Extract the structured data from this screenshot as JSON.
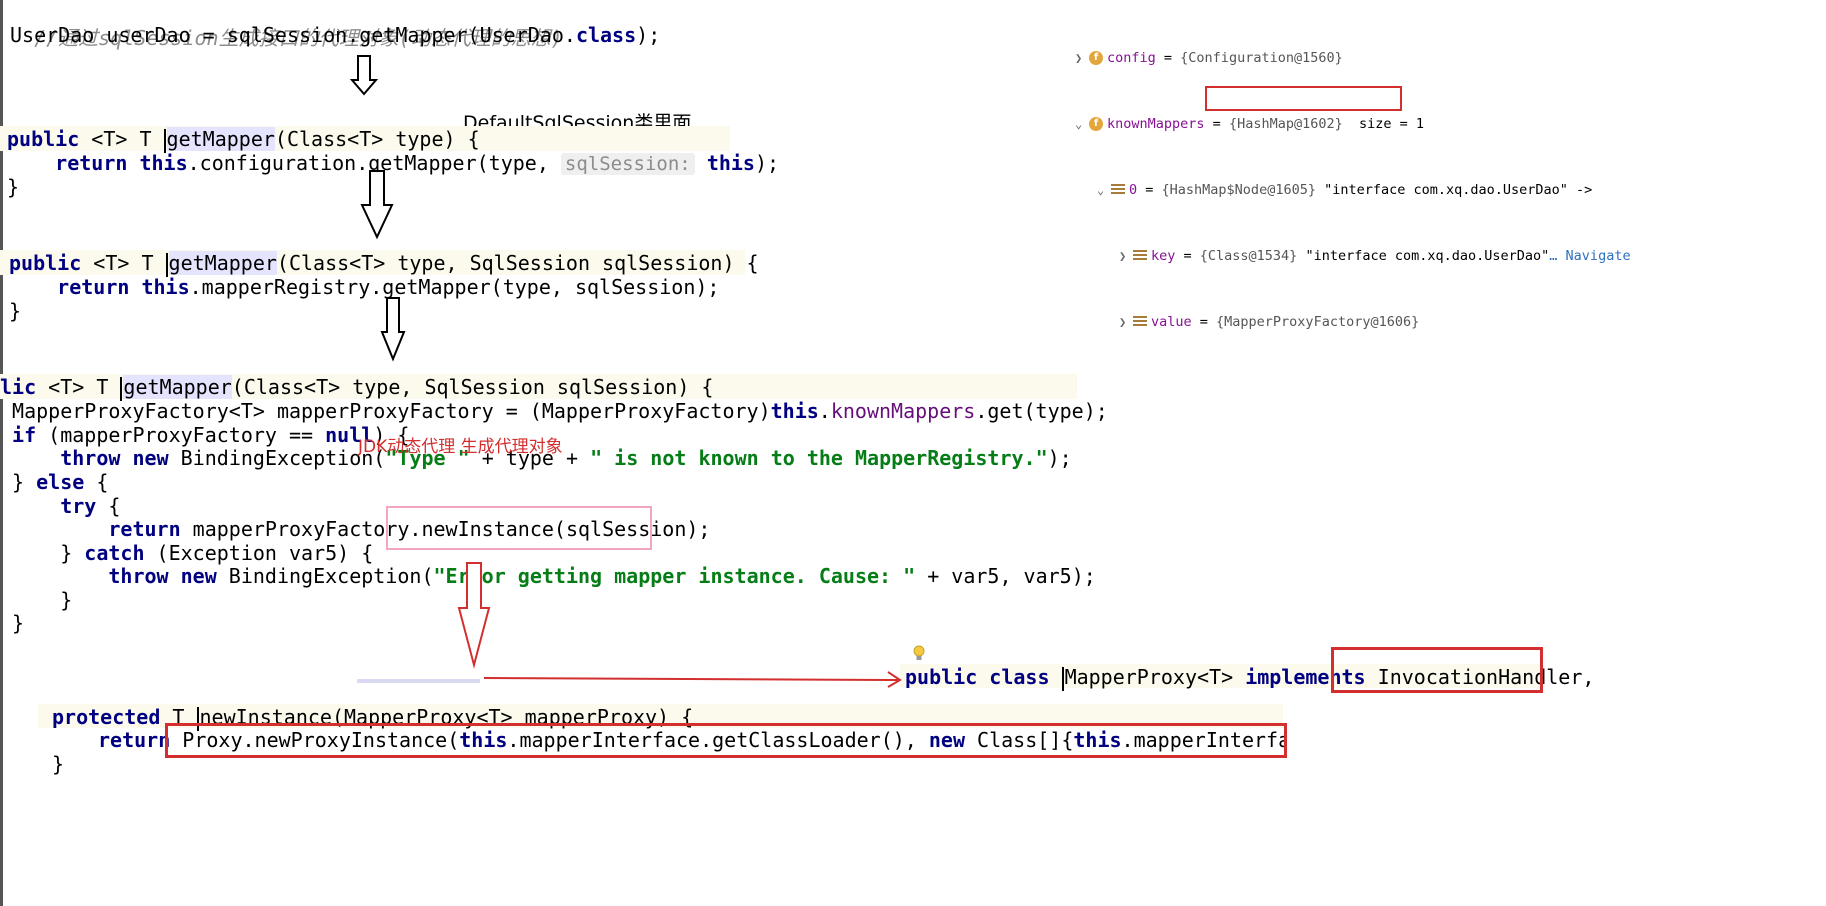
{
  "top_snippet": {
    "comment": "//通过sqlSession生成接口的代理对象(动态代理的思想)",
    "line": [
      "UserDao userDao = sqlSession.getMapper(UserDao.",
      "class",
      ");"
    ]
  },
  "annotation_default": "DefaultSqlSession类里面",
  "annotation_jdk": "JDK动态代理 生成代理对象",
  "block1": {
    "sig": [
      "public",
      " <T> T ",
      "getMapper",
      "(Class<T> type) {"
    ],
    "body": [
      "    ",
      "return",
      " ",
      "this",
      ".configuration.getMapper(type, ",
      "sqlSession:",
      " ",
      "this",
      ");"
    ],
    "close": "}"
  },
  "block2": {
    "sig": [
      "public",
      " <T> T ",
      "getMapper",
      "(Class<T> type, SqlSession sqlSession) {"
    ],
    "body": [
      "    ",
      "return",
      " ",
      "this",
      ".mapperRegistry.getMapper(type, sqlSession);"
    ],
    "close": "}"
  },
  "block3": {
    "sig": [
      "lic",
      " <T> T ",
      "getMapper",
      "(Class<T> type, SqlSession sqlSession) {"
    ],
    "l1": [
      " MapperProxyFactory<T> mapperProxyFactory = (MapperProxyFactory)",
      "this",
      ".",
      "knownMappers",
      ".get(type);"
    ],
    "l2": [
      " ",
      "if",
      " (mapperProxyFactory == ",
      "null",
      ") {"
    ],
    "l3": [
      "     ",
      "throw",
      " ",
      "new",
      " BindingException(",
      "\"Type \"",
      " + type + ",
      "\" is not known to the MapperRegistry.\"",
      ");"
    ],
    "l4": [
      " } ",
      "else",
      " {"
    ],
    "l5": [
      "     ",
      "try",
      " {"
    ],
    "l6": [
      "         ",
      "return",
      " mapperProxyFactory.",
      "newInstance(sqlSession)",
      ";"
    ],
    "l7": [
      "     } ",
      "catch",
      " (Exception var5) {"
    ],
    "l8": [
      "         ",
      "throw",
      " ",
      "new",
      " BindingException(",
      "\"Error getting mapper instance. Cause: \"",
      " + var5, var5);"
    ],
    "l9": "     }",
    "l10": " }"
  },
  "block4": {
    "sig": [
      "protected",
      " T ",
      "newInstance",
      "(MapperProxy<T> mapperProxy) {"
    ],
    "body": [
      "return",
      " ",
      "Proxy.newProxyInstance(",
      "this",
      ".mapperInterface.getClassLoader(), ",
      "new",
      " Class[]{",
      "this",
      ".mapperInterface}, map"
    ],
    "close": "}"
  },
  "block5": {
    "line": [
      "public",
      " ",
      "class",
      " ",
      "MapperProxy",
      "<T> ",
      "implements",
      " ",
      "InvocationHandler,"
    ]
  },
  "debugger": {
    "rows": [
      {
        "name": "config",
        "value": "{Configuration@1560}",
        "extra": ""
      },
      {
        "name": "knownMappers",
        "value": "{HashMap@1602}",
        "extra": "  size = 1"
      },
      {
        "name": "0",
        "value": "{HashMap$Node@1605}",
        "extra": " \"interface com.xq.dao.UserDao\" ->"
      },
      {
        "name": "key",
        "value": "{Class@1534}",
        "extra": " \"interface com.xq.dao.UserDao\"",
        "nav": "… Navigate"
      },
      {
        "name": "value",
        "value": "{MapperProxyFactory@1606}",
        "extra": ""
      }
    ]
  },
  "colors": {
    "keyword": "#000080",
    "string": "#067d17",
    "annotation_red": "#d32f2f",
    "current_line": "#fcfaed",
    "method_highlight": "#e4e4ff"
  }
}
